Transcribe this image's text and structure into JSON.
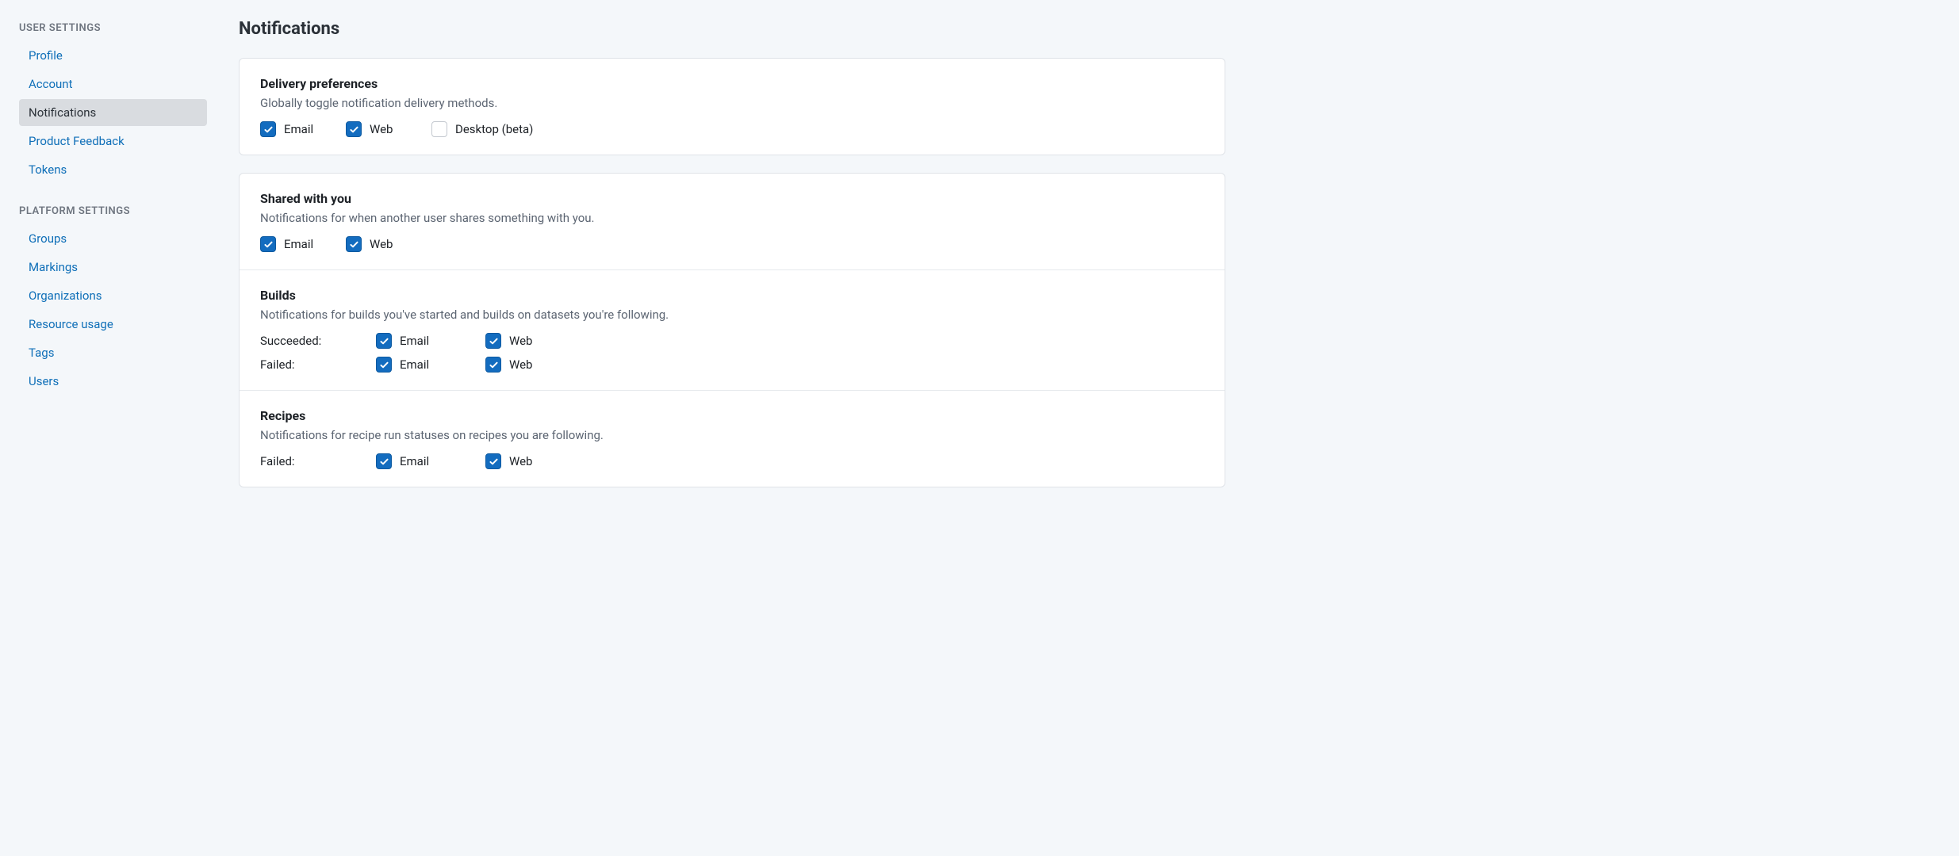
{
  "sidebar": {
    "group1_title": "USER SETTINGS",
    "group1_items": {
      "profile": "Profile",
      "account": "Account",
      "notifications": "Notifications",
      "product_feedback": "Product Feedback",
      "tokens": "Tokens"
    },
    "group2_title": "PLATFORM SETTINGS",
    "group2_items": {
      "groups": "Groups",
      "markings": "Markings",
      "organizations": "Organizations",
      "resource_usage": "Resource usage",
      "tags": "Tags",
      "users": "Users"
    }
  },
  "page_title": "Notifications",
  "delivery": {
    "title": "Delivery preferences",
    "desc": "Globally toggle notification delivery methods.",
    "email": {
      "label": "Email",
      "checked": true
    },
    "web": {
      "label": "Web",
      "checked": true
    },
    "desktop": {
      "label": "Desktop (beta)",
      "checked": false
    }
  },
  "shared": {
    "title": "Shared with you",
    "desc": "Notifications for when another user shares something with you.",
    "email": {
      "label": "Email",
      "checked": true
    },
    "web": {
      "label": "Web",
      "checked": true
    }
  },
  "builds": {
    "title": "Builds",
    "desc": "Notifications for builds you've started and builds on datasets you're following.",
    "succeeded": {
      "label": "Succeeded:",
      "email": {
        "label": "Email",
        "checked": true
      },
      "web": {
        "label": "Web",
        "checked": true
      }
    },
    "failed": {
      "label": "Failed:",
      "email": {
        "label": "Email",
        "checked": true
      },
      "web": {
        "label": "Web",
        "checked": true
      }
    }
  },
  "recipes": {
    "title": "Recipes",
    "desc": "Notifications for recipe run statuses on recipes you are following.",
    "failed": {
      "label": "Failed:",
      "email": {
        "label": "Email",
        "checked": true
      },
      "web": {
        "label": "Web",
        "checked": true
      }
    }
  }
}
